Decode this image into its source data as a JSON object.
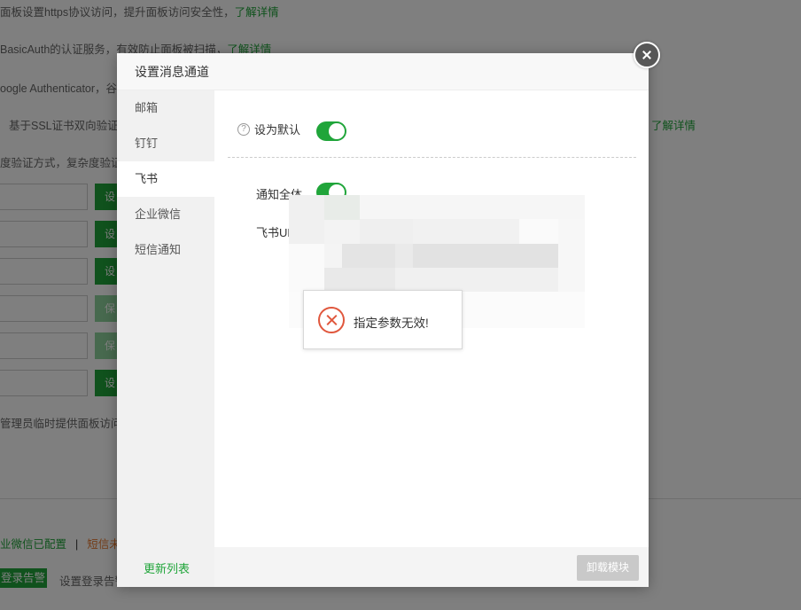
{
  "background": {
    "lines": [
      {
        "text": "面板设置https协议访问，提升面板访问安全性，",
        "link": "了解详情"
      },
      {
        "text": "BasicAuth的认证服务，有效防止面板被扫描，",
        "link": "了解详情"
      },
      {
        "text": "oogle Authenticator，谷",
        "link": ""
      },
      {
        "text": "基于SSL证书双向验证，",
        "link": "了解详情"
      },
      {
        "text": "度验证方式，复杂度验证和",
        "link": ""
      }
    ],
    "buttons": [
      "设",
      "设",
      "设",
      "保",
      "保",
      "设"
    ],
    "temp_access_text": "管理员临时提供面板访问权",
    "status_wechat": "业微信已配置",
    "status_separator": "|",
    "status_sms": "短信未配置",
    "login_alert_button": "登录告警",
    "login_alert_label": "设置登录告警"
  },
  "dialog": {
    "title": "设置消息通道",
    "sidebar": [
      {
        "label": "邮箱",
        "active": false
      },
      {
        "label": "钉钉",
        "active": false
      },
      {
        "label": "飞书",
        "active": true
      },
      {
        "label": "企业微信",
        "active": false
      },
      {
        "label": "短信通知",
        "active": false
      }
    ],
    "refresh_label": "更新列表",
    "set_default_label": "设为默认",
    "set_default_on": true,
    "help_icon_glyph": "?",
    "notify_all_label": "通知全体",
    "notify_all_on": true,
    "url_label": "飞书URL",
    "url_value": "",
    "unload_button": "卸载模块"
  },
  "toast": {
    "message": "指定参数无效!",
    "icon": "error-circle-icon",
    "color": "#e0573d"
  },
  "colors": {
    "accent": "#20a53a",
    "warning": "#e6772c"
  }
}
